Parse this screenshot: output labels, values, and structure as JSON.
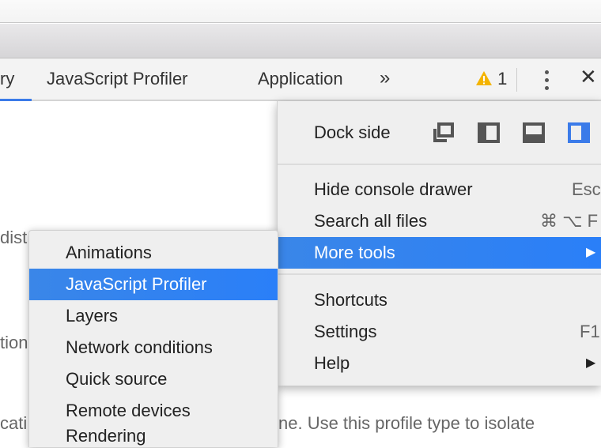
{
  "tabs": [
    {
      "label": "ry",
      "active": true
    },
    {
      "label": "JavaScript Profiler"
    },
    {
      "label": "Application"
    }
  ],
  "overflow_label": "»",
  "warnings": {
    "count": "1",
    "icon": "warning-triangle-icon",
    "color": "#f4b400"
  },
  "close_label": "✕",
  "background_text": [
    "dist",
    "tion",
    "cati",
    "ne. Use this profile type to isolate"
  ],
  "menu": {
    "dock_label": "Dock side",
    "dock_options": [
      "undock",
      "dock-left",
      "dock-bottom",
      "dock-right"
    ],
    "dock_selected": "dock-right",
    "items": [
      {
        "label": "Hide console drawer",
        "shortcut": "Esc"
      },
      {
        "label": "Search all files",
        "shortcut": "⌘ ⌥ F"
      },
      {
        "label": "More tools",
        "submenu": true,
        "highlighted": true
      },
      {
        "label": "Shortcuts"
      },
      {
        "label": "Settings",
        "shortcut": "F1"
      },
      {
        "label": "Help",
        "submenu": true
      }
    ]
  },
  "submenu": {
    "items": [
      "Animations",
      "JavaScript Profiler",
      "Layers",
      "Network conditions",
      "Quick source",
      "Remote devices",
      "Rendering"
    ],
    "highlighted": "JavaScript Profiler"
  },
  "accent": "#2a7ff8"
}
